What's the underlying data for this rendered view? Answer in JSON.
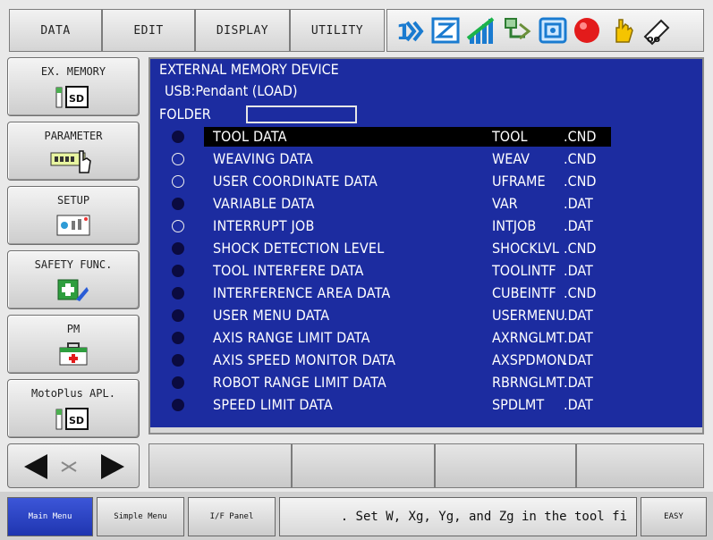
{
  "menu": {
    "items": [
      "DATA",
      "EDIT",
      "DISPLAY",
      "UTILITY"
    ]
  },
  "status_icons": [
    "security-mode-icon",
    "cycle-mode-icon",
    "signal-level-icon",
    "jog-frame-icon",
    "play-mode-icon",
    "servo-status-icon",
    "hand-icon",
    "manual-speed-icon"
  ],
  "sidebar": {
    "items": [
      {
        "label": "EX. MEMORY",
        "icon": "sd-card-icon"
      },
      {
        "label": "PARAMETER",
        "icon": "parameter-icon"
      },
      {
        "label": "SETUP",
        "icon": "setup-icon"
      },
      {
        "label": "SAFETY FUNC.",
        "icon": "safety-icon"
      },
      {
        "label": "PM",
        "icon": "medical-kit-icon"
      },
      {
        "label": "MotoPlus APL.",
        "icon": "sd-card-icon"
      }
    ]
  },
  "header": {
    "title": "EXTERNAL MEMORY DEVICE",
    "device": "USB:Pendant (LOAD)",
    "folder_label": "FOLDER",
    "folder_value": ""
  },
  "files": [
    {
      "name": "TOOL DATA",
      "file": "TOOL",
      "ext": ".CND",
      "selected": true,
      "highlight": true
    },
    {
      "name": "WEAVING DATA",
      "file": "WEAV",
      "ext": ".CND",
      "selected": false,
      "highlight": false
    },
    {
      "name": "USER COORDINATE DATA",
      "file": "UFRAME",
      "ext": ".CND",
      "selected": false,
      "highlight": false
    },
    {
      "name": "VARIABLE DATA",
      "file": "VAR",
      "ext": ".DAT",
      "selected": true,
      "highlight": false
    },
    {
      "name": "INTERRUPT JOB",
      "file": "INTJOB",
      "ext": ".DAT",
      "selected": false,
      "highlight": false
    },
    {
      "name": "SHOCK DETECTION LEVEL",
      "file": "SHOCKLVL",
      "ext": ".CND",
      "selected": true,
      "highlight": false
    },
    {
      "name": "TOOL INTERFERE DATA",
      "file": "TOOLINTF",
      "ext": ".DAT",
      "selected": true,
      "highlight": false
    },
    {
      "name": "INTERFERENCE AREA DATA",
      "file": "CUBEINTF",
      "ext": ".CND",
      "selected": true,
      "highlight": false
    },
    {
      "name": "USER MENU DATA",
      "file": "USERMENU",
      "ext": ".DAT",
      "selected": true,
      "highlight": false
    },
    {
      "name": "AXIS RANGE LIMIT DATA",
      "file": "AXRNGLMT",
      "ext": ".DAT",
      "selected": true,
      "highlight": false
    },
    {
      "name": "AXIS SPEED MONITOR DATA",
      "file": "AXSPDMON",
      "ext": ".DAT",
      "selected": true,
      "highlight": false
    },
    {
      "name": "ROBOT RANGE LIMIT DATA",
      "file": "RBRNGLMT",
      "ext": ".DAT",
      "selected": true,
      "highlight": false
    },
    {
      "name": "SPEED LIMIT DATA",
      "file": "SPDLMT",
      "ext": ".DAT",
      "selected": true,
      "highlight": false
    }
  ],
  "bottom": {
    "main_menu": "Main Menu",
    "simple_menu": "Simple Menu",
    "if_panel": "I/F Panel",
    "message": ". Set W, Xg, Yg, and Zg in the tool fi",
    "easy": "EASY"
  },
  "colors": {
    "content_bg": "#1c2ca0",
    "highlight_row": "#000000",
    "main_menu_bg": "#2a42c8"
  }
}
